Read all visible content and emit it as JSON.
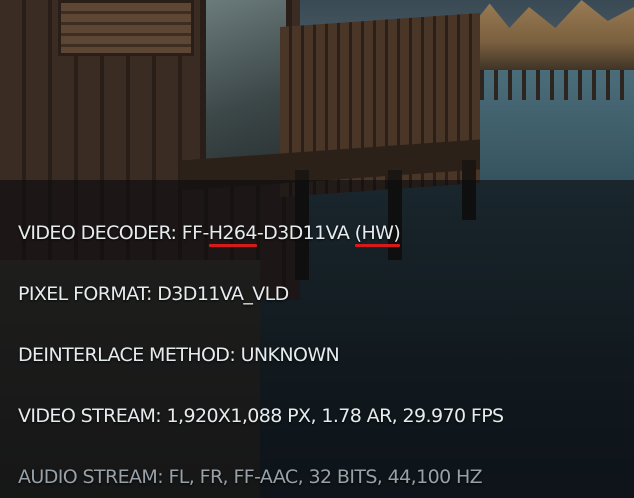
{
  "player_info": {
    "video_decoder": {
      "prefix": "VIDEO DECODER: FF-",
      "codec": "H264",
      "middle": "-D3D11VA ",
      "mode": "(HW)"
    },
    "pixel_format": "PIXEL FORMAT: D3D11VA_VLD",
    "deinterlace_method": "DEINTERLACE METHOD: UNKNOWN",
    "video_stream": "VIDEO STREAM: 1,920X1,088 PX, 1.78 AR, 29.970 FPS",
    "audio_stream": "AUDIO STREAM: FL, FR, FF-AAC, 32 BITS, 44,100 HZ"
  },
  "colors": {
    "highlight_underline": "#d6191b",
    "text_primary": "#e6ebee",
    "text_dim": "#97a1a7"
  }
}
